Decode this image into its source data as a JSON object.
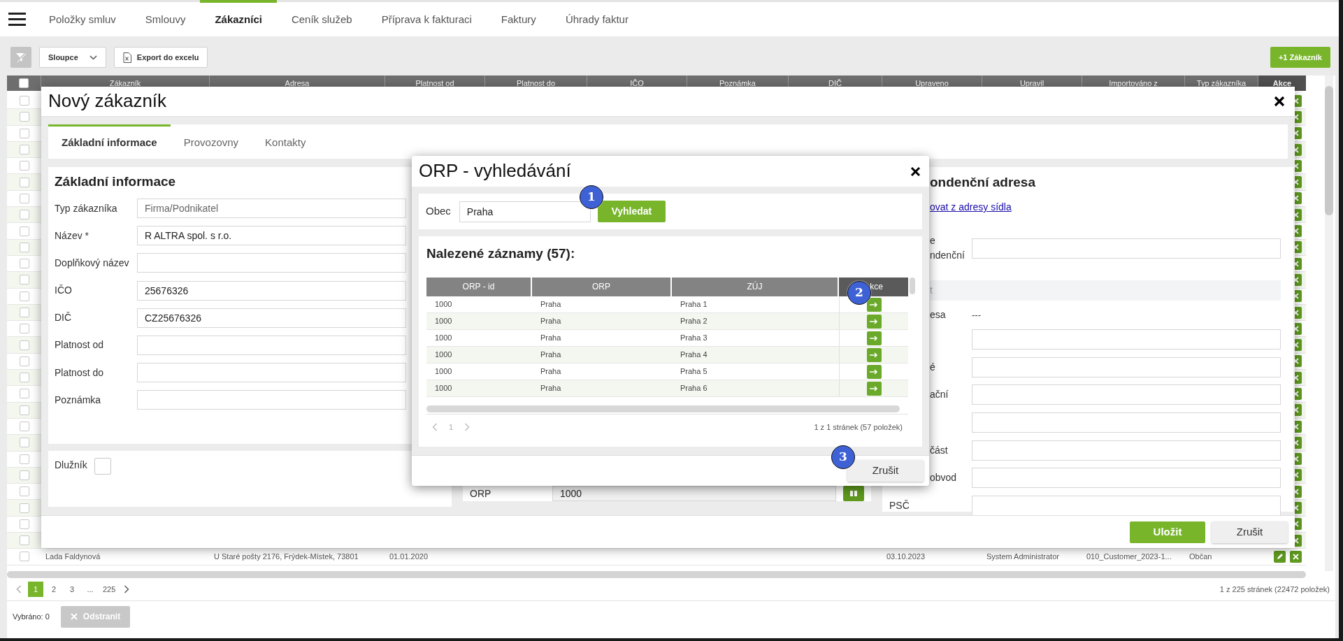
{
  "nav": {
    "tabs": [
      {
        "label": "Položky smluv",
        "selected": false
      },
      {
        "label": "Smlouvy",
        "selected": false
      },
      {
        "label": "Zákazníci",
        "selected": true
      },
      {
        "label": "Ceník služeb",
        "selected": false
      },
      {
        "label": "Příprava k fakturaci",
        "selected": false
      },
      {
        "label": "Faktury",
        "selected": false
      },
      {
        "label": "Úhrady faktur",
        "selected": false
      }
    ]
  },
  "toolbar": {
    "columns_button": "Sloupce",
    "export_button": "Export do excelu",
    "add_button": "+1 Zákazník"
  },
  "table": {
    "all_selected": false,
    "columns": [
      "Zákazník",
      "Adresa",
      "Platnost od",
      "Platnost do",
      "IČO",
      "Poznámka",
      "DIČ",
      "Upraveno",
      "Upravil",
      "Importováno z",
      "Typ zákazníka",
      "Akce"
    ],
    "rows": [
      {
        "selected": false
      },
      {
        "selected": false
      },
      {
        "selected": false
      },
      {
        "selected": false
      },
      {
        "selected": false
      },
      {
        "selected": false
      },
      {
        "selected": false
      },
      {
        "selected": false
      },
      {
        "selected": false
      },
      {
        "selected": false
      },
      {
        "selected": false
      },
      {
        "selected": false
      },
      {
        "selected": false
      },
      {
        "selected": false
      },
      {
        "selected": false
      },
      {
        "selected": false
      },
      {
        "selected": false
      },
      {
        "selected": false
      },
      {
        "selected": false
      },
      {
        "selected": false
      },
      {
        "selected": false
      },
      {
        "selected": false
      },
      {
        "selected": false
      },
      {
        "selected": false
      },
      {
        "selected": false
      },
      {
        "selected": false
      },
      {
        "selected": false
      },
      {
        "selected": false
      },
      {
        "selected": false,
        "cells": [
          "Lada Faldynová",
          "U Staré pošty 2176, Frýdek-Místek, 73801",
          "01.01.2020",
          null,
          null,
          null,
          null,
          "03.10.2023",
          "System Administrator",
          "010_Customer_2023-1...",
          "Občan"
        ]
      }
    ]
  },
  "pagination": {
    "pages": [
      {
        "label": "1",
        "selected": true
      },
      {
        "label": "2",
        "selected": false
      },
      {
        "label": "3",
        "selected": false
      },
      {
        "label": "...",
        "selected": false
      },
      {
        "label": "225",
        "selected": false
      }
    ],
    "summary": "1 z 225 stránek (22472 položek)"
  },
  "footer": {
    "selected_count": "Vybráno: 0",
    "delete_button": {
      "label": "Odstranit",
      "disabled": true
    }
  },
  "modal": {
    "title": "Nový zákazník",
    "tabs": [
      {
        "label": "Základní informace",
        "selected": true
      },
      {
        "label": "Provozovny",
        "selected": false
      },
      {
        "label": "Kontakty",
        "selected": false
      }
    ],
    "basic_info": {
      "heading": "Základní informace",
      "fields": [
        {
          "label": "Typ zákazníka",
          "value": "Firma/Podnikatel",
          "readonly": true
        },
        {
          "label": "Název *",
          "value": "R ALTRA spol. s r.o.",
          "readonly": false
        },
        {
          "label": "Doplňkový název"
        },
        {
          "label": "IČO",
          "value": "25676326",
          "readonly": false
        },
        {
          "label": "DIČ",
          "value": "CZ25676326",
          "readonly": false
        },
        {
          "label": "Platnost od"
        },
        {
          "label": "Platnost do"
        },
        {
          "label": "Poznámka"
        }
      ]
    },
    "debtor": {
      "label": "Dlužník",
      "checked": false
    },
    "middle": {
      "label": "ORP",
      "value": "1000"
    },
    "correspondence": {
      "heading": "ondenční adresa",
      "copy_link": "ovat z adresy sídla",
      "rows": [
        {
          "kind": "input",
          "label_lines": [
            "e",
            "ndenční"
          ],
          "under_dialog": true
        },
        {
          "kind": "section",
          "label": "t",
          "under_dialog": true
        },
        {
          "kind": "text",
          "label": "esa",
          "value": "---",
          "under_dialog": true
        },
        {
          "kind": "input"
        },
        {
          "kind": "input",
          "label": "é",
          "under_dialog": true
        },
        {
          "kind": "input",
          "label": "ační",
          "under_dialog": true
        },
        {
          "kind": "input"
        },
        {
          "kind": "input",
          "label": "část",
          "under_dialog": true
        },
        {
          "kind": "input",
          "label": "obvod",
          "under_dialog": true
        },
        {
          "kind": "input",
          "label": "PSČ"
        }
      ]
    },
    "buttons": {
      "save": "Uložit",
      "cancel": "Zrušit"
    }
  },
  "orp_dialog": {
    "title": "ORP - vyhledávání",
    "search": {
      "label": "Obec",
      "value": "Praha",
      "button": "Vyhledat",
      "badge": "1"
    },
    "results": {
      "heading": "Nalezené záznamy (57):",
      "badge": "2",
      "columns": [
        "ORP - id",
        "ORP",
        "ZÚJ",
        "kce"
      ],
      "rows": [
        [
          "1000",
          "Praha",
          "Praha 1"
        ],
        [
          "1000",
          "Praha",
          "Praha 2"
        ],
        [
          "1000",
          "Praha",
          "Praha 3"
        ],
        [
          "1000",
          "Praha",
          "Praha 4"
        ],
        [
          "1000",
          "Praha",
          "Praha 5"
        ],
        [
          "1000",
          "Praha",
          "Praha 6"
        ]
      ],
      "pages": [
        {
          "label": "1",
          "selected": true
        }
      ],
      "summary": "1 z 1 stránek (57 položek)"
    },
    "cancel": "Zrušit",
    "cancel_badge": "3"
  }
}
